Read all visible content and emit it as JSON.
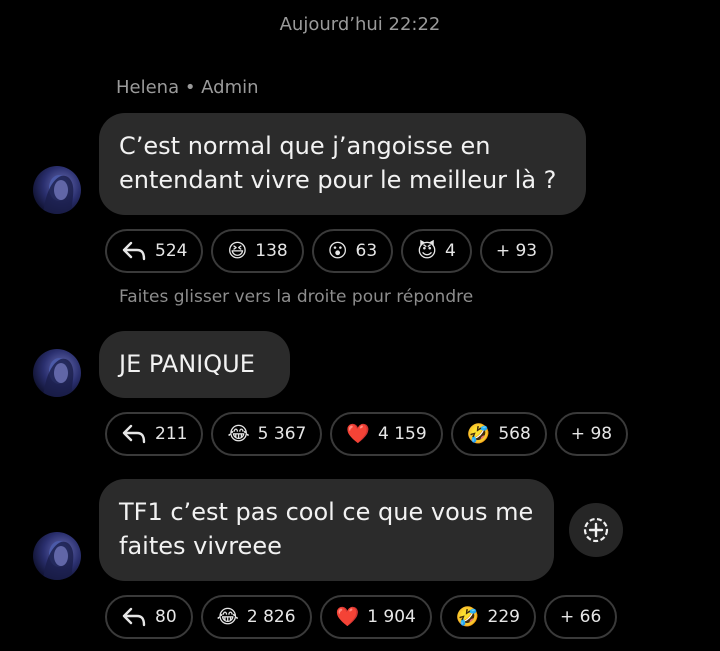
{
  "timestamp": "Aujourd’hui 22:22",
  "sender": "Helena • Admin",
  "hint": "Faites glisser vers la droite pour répondre",
  "messages": [
    {
      "text_lines": [
        "C’est normal que j’angoisse en",
        "entendant vivre pour le meilleur là ?"
      ],
      "reactions": {
        "reply_count": "524",
        "r1_emoji": "😆",
        "r1_count": "138",
        "r2_emoji": "😮",
        "r2_count": "63",
        "r3_emoji": "😈",
        "r3_count": "4",
        "more": "+ 93"
      }
    },
    {
      "text_lines": [
        "JE PANIQUE"
      ],
      "reactions": {
        "reply_count": "211",
        "r1_emoji": "😂",
        "r1_count": "5 367",
        "r2_emoji": "❤️",
        "r2_count": "4 159",
        "r3_emoji": "🤣",
        "r3_count": "568",
        "more": "+ 98"
      }
    },
    {
      "text_lines": [
        "TF1 c’est pas cool ce que vous me",
        "faites vivreee"
      ],
      "reactions": {
        "reply_count": "80",
        "r1_emoji": "😂",
        "r1_count": "2 826",
        "r2_emoji": "❤️",
        "r2_count": "1 904",
        "r3_emoji": "🤣",
        "r3_count": "229",
        "more": "+ 66"
      }
    }
  ],
  "icons": {
    "reply": "reply-arrow-icon",
    "add_reaction": "add-reaction-icon"
  },
  "colors": {
    "background": "#000000",
    "bubble": "#2b2b2b",
    "chip_border": "#3a3a3a",
    "muted_text": "#9a9a9a"
  }
}
